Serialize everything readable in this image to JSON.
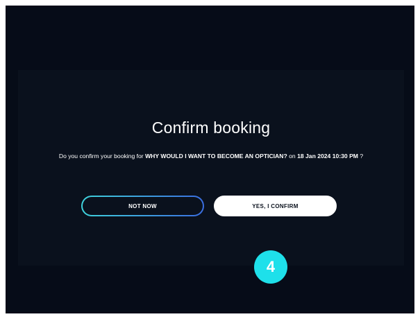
{
  "modal": {
    "title": "Confirm booking",
    "message_prefix": "Do you confirm your booking for ",
    "event_title": "WHY WOULD I WANT TO BECOME AN OPTICIAN?",
    "message_middle": " on ",
    "event_datetime": "18 Jan 2024 10:30 PM",
    "message_suffix": " ?",
    "buttons": {
      "not_now_label": "NOT NOW",
      "confirm_label": "YES, I CONFIRM"
    }
  },
  "step_badge": {
    "number": "4"
  },
  "colors": {
    "background": "#060c18",
    "panel": "#0a111d",
    "accent_cyan": "#1ee0ea",
    "accent_blue": "#3a6de0",
    "text": "#ffffff"
  }
}
